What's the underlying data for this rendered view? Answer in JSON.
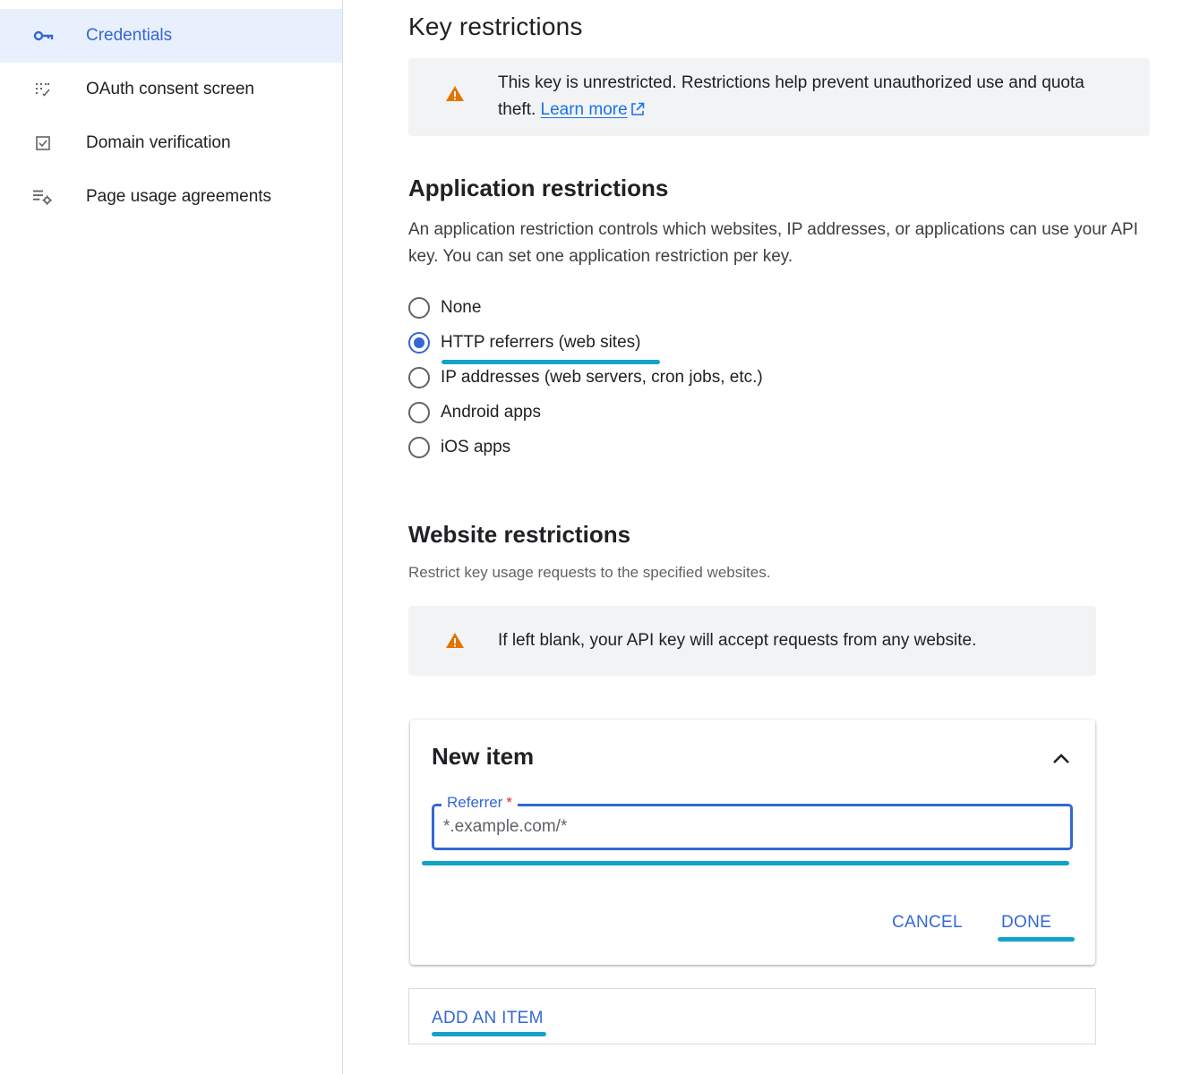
{
  "sidebar": {
    "items": [
      {
        "label": "Credentials",
        "icon": "key-icon",
        "active": true
      },
      {
        "label": "OAuth consent screen",
        "icon": "oauth-consent-icon",
        "active": false
      },
      {
        "label": "Domain verification",
        "icon": "checkbox-icon",
        "active": false
      },
      {
        "label": "Page usage agreements",
        "icon": "list-settings-icon",
        "active": false
      }
    ]
  },
  "key_restrictions": {
    "title": "Key restrictions",
    "warning_text": "This key is unrestricted. Restrictions help prevent unauthorized use and quota theft.",
    "learn_more": "Learn more"
  },
  "application_restrictions": {
    "title": "Application restrictions",
    "description": "An application restriction controls which websites, IP addresses, or applications can use your API key. You can set one application restriction per key.",
    "options": [
      {
        "label": "None",
        "checked": false
      },
      {
        "label": "HTTP referrers (web sites)",
        "checked": true
      },
      {
        "label": "IP addresses (web servers, cron jobs, etc.)",
        "checked": false
      },
      {
        "label": "Android apps",
        "checked": false
      },
      {
        "label": "iOS apps",
        "checked": false
      }
    ]
  },
  "website_restrictions": {
    "title": "Website restrictions",
    "description": "Restrict key usage requests to the specified websites.",
    "warning_text": "If left blank, your API key will accept requests from any website."
  },
  "new_item": {
    "title": "New item",
    "field_label": "Referrer",
    "required_mark": "*",
    "placeholder": "*.example.com/*",
    "value": "",
    "cancel_label": "CANCEL",
    "done_label": "DONE"
  },
  "add_item_label": "ADD AN ITEM",
  "colors": {
    "accent": "#3367d6",
    "link": "#1a73e8",
    "warning": "#e37400",
    "highlight": "#12a4c8",
    "active_nav_bg": "#e8f0fe"
  }
}
